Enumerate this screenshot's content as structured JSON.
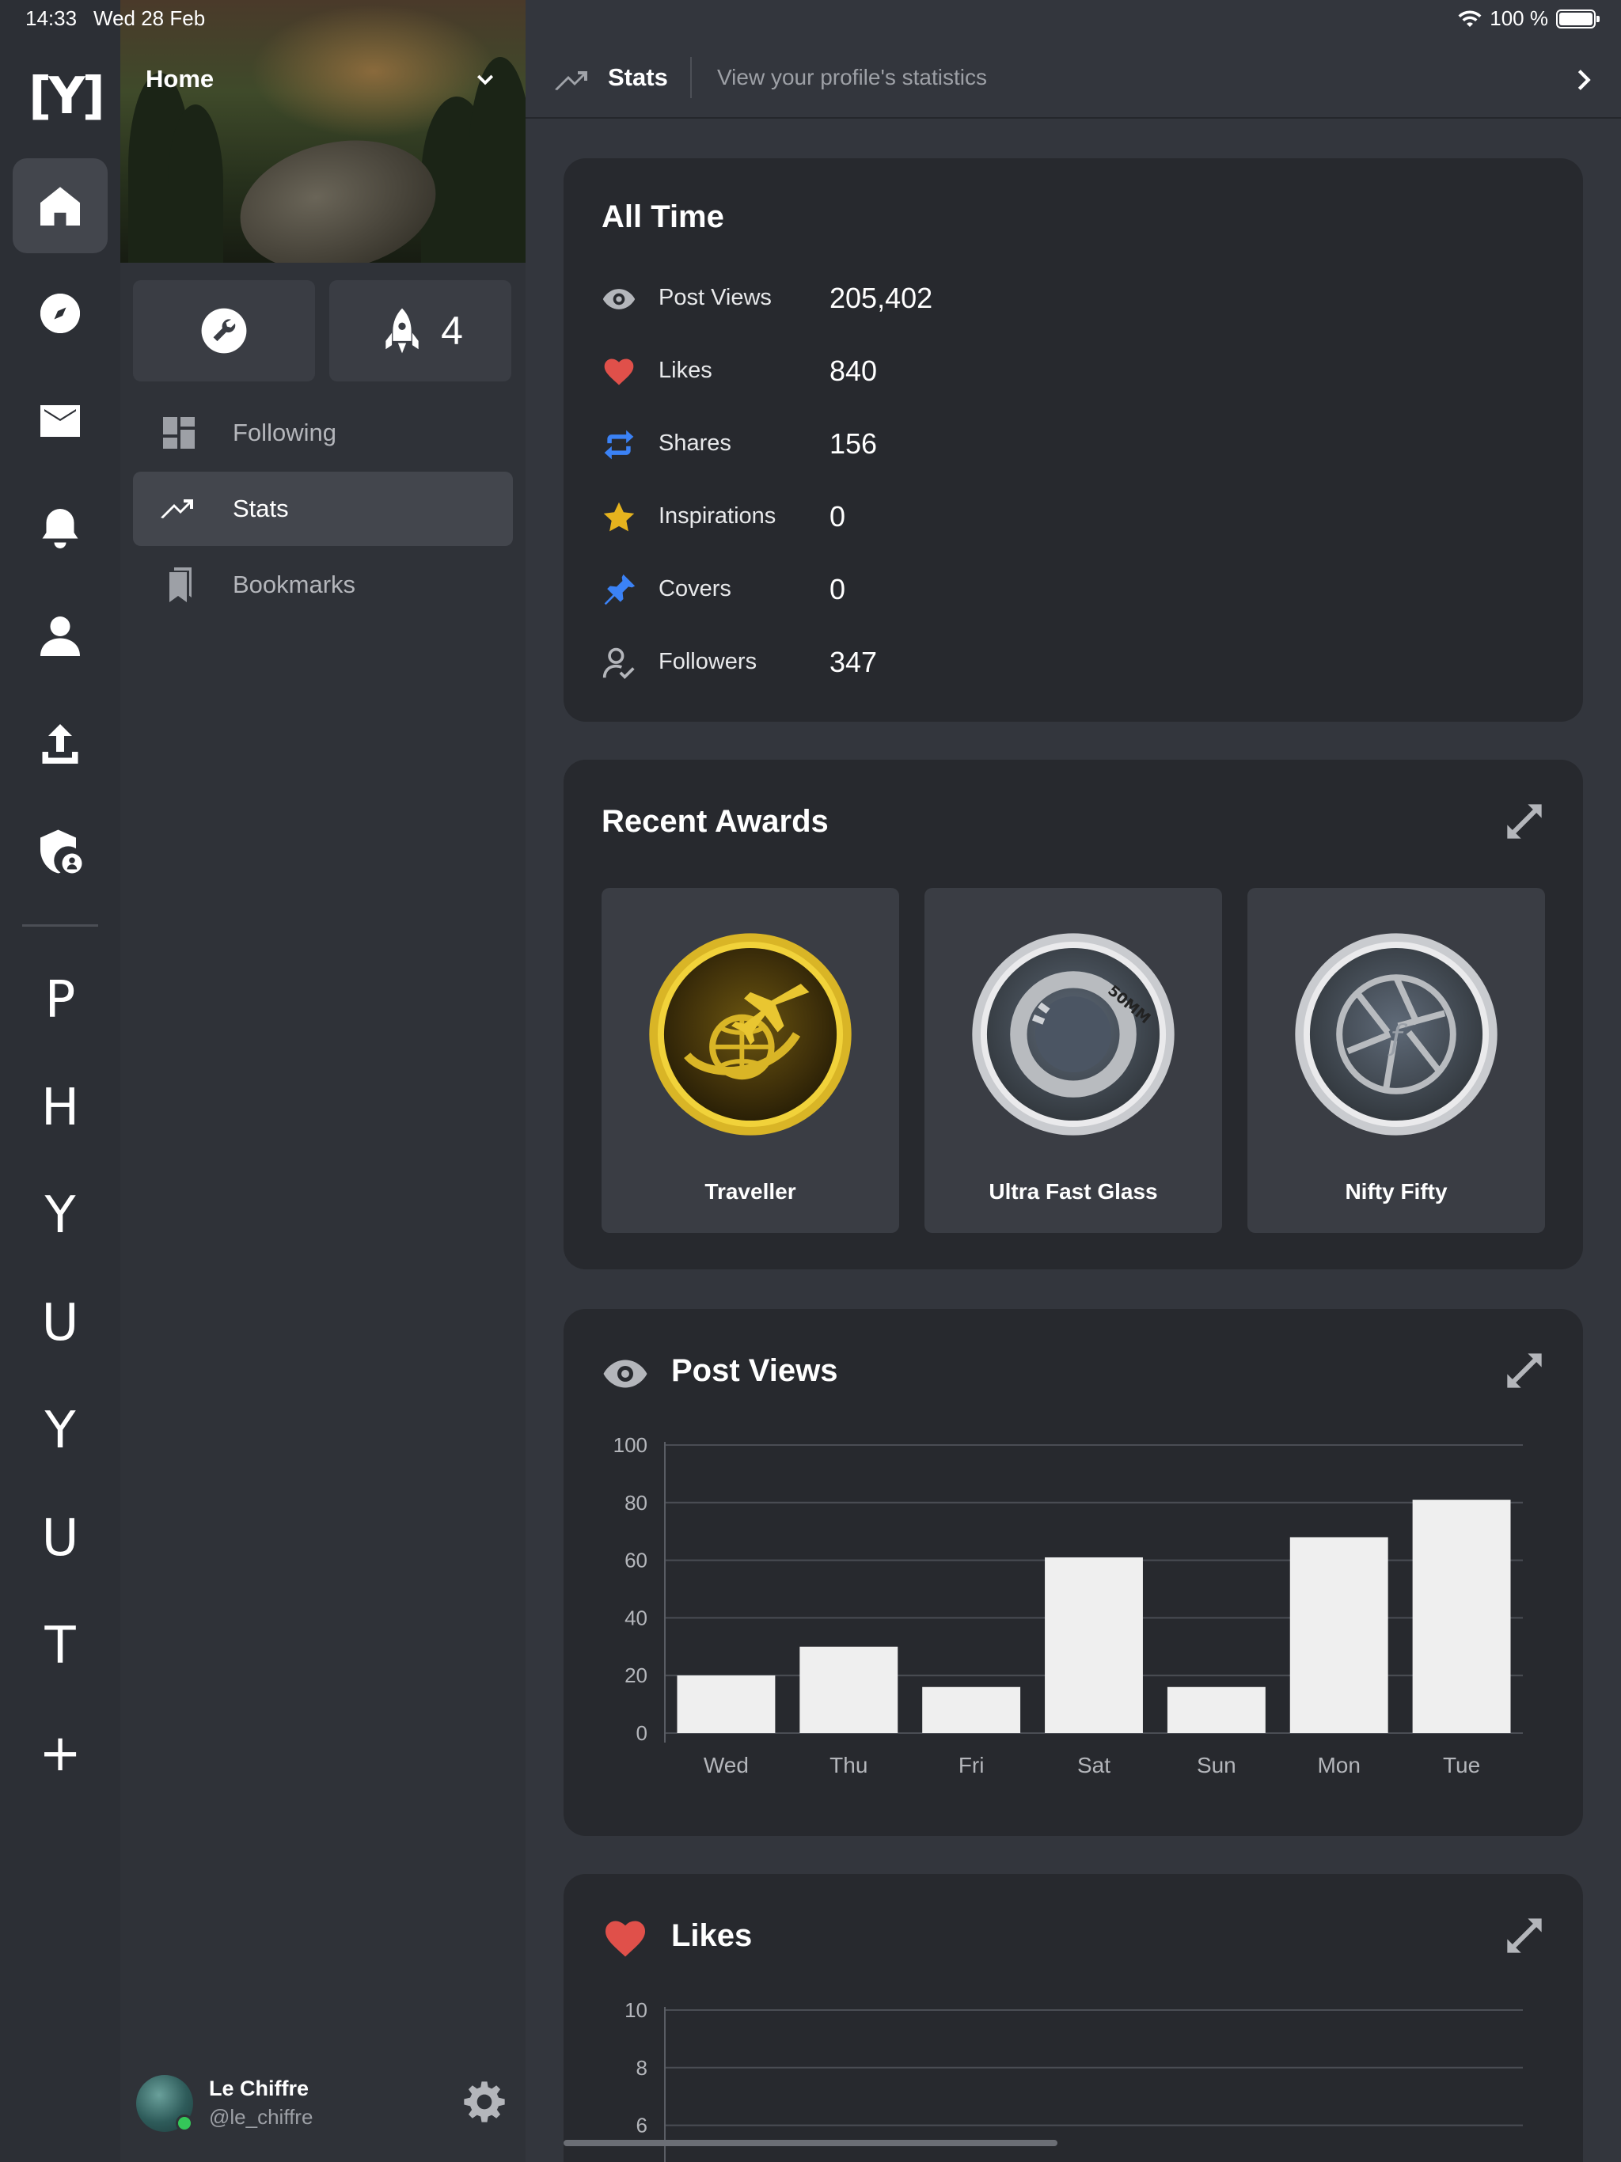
{
  "status_bar": {
    "time": "14:33",
    "date": "Wed 28 Feb",
    "battery": "100 %",
    "battery_level": 1.0
  },
  "rail": {
    "logo": "[Y]",
    "icons": [
      "home-icon",
      "compass-icon",
      "mail-icon",
      "bell-icon",
      "person-icon",
      "upload-icon",
      "shield-user-icon"
    ],
    "letters": [
      "P",
      "H",
      "Y",
      "U",
      "Y",
      "U",
      "T"
    ],
    "add_label": "+"
  },
  "sidebar": {
    "hero_title": "Home",
    "tools_icon": "wrench-icon",
    "rocket_count": "4",
    "nav": [
      {
        "label": "Following",
        "icon": "dashboard-icon"
      },
      {
        "label": "Stats",
        "icon": "trending-icon"
      },
      {
        "label": "Bookmarks",
        "icon": "bookmarks-icon"
      }
    ],
    "profile": {
      "name": "Le Chiffre",
      "handle": "@le_chiffre"
    }
  },
  "topbar": {
    "title": "Stats",
    "subtitle": "View your profile's statistics"
  },
  "all_time": {
    "title": "All Time",
    "rows": [
      {
        "label": "Post Views",
        "value": "205,402",
        "icon": "eye-icon"
      },
      {
        "label": "Likes",
        "value": "840",
        "icon": "heart-icon"
      },
      {
        "label": "Shares",
        "value": "156",
        "icon": "share-icon"
      },
      {
        "label": "Inspirations",
        "value": "0",
        "icon": "star-icon"
      },
      {
        "label": "Covers",
        "value": "0",
        "icon": "pin-icon"
      },
      {
        "label": "Followers",
        "value": "347",
        "icon": "follower-icon"
      }
    ]
  },
  "awards": {
    "title": "Recent Awards",
    "items": [
      {
        "name": "Traveller",
        "badge_text": ""
      },
      {
        "name": "Ultra Fast Glass",
        "badge_text": "50MM"
      },
      {
        "name": "Nifty Fifty",
        "badge_text": "f"
      }
    ]
  },
  "post_views": {
    "title": "Post Views"
  },
  "likes": {
    "title": "Likes"
  },
  "colors": {
    "heart": "#e0504a",
    "share": "#3b82f6",
    "star": "#e6b31e",
    "pin": "#3b82f6",
    "bar": "#efefef",
    "gold": "#d9b526"
  },
  "chart_data": [
    {
      "type": "bar",
      "title": "Post Views",
      "categories": [
        "Wed",
        "Thu",
        "Fri",
        "Sat",
        "Sun",
        "Mon",
        "Tue"
      ],
      "values": [
        20,
        30,
        16,
        61,
        16,
        68,
        81
      ],
      "ylim": [
        0,
        100
      ],
      "yticks": [
        0,
        20,
        40,
        60,
        80,
        100
      ],
      "grid": true
    },
    {
      "type": "bar",
      "title": "Likes",
      "categories": [],
      "values": [],
      "ylim": [
        0,
        10
      ],
      "yticks": [
        6,
        8,
        10
      ],
      "grid": true
    }
  ]
}
